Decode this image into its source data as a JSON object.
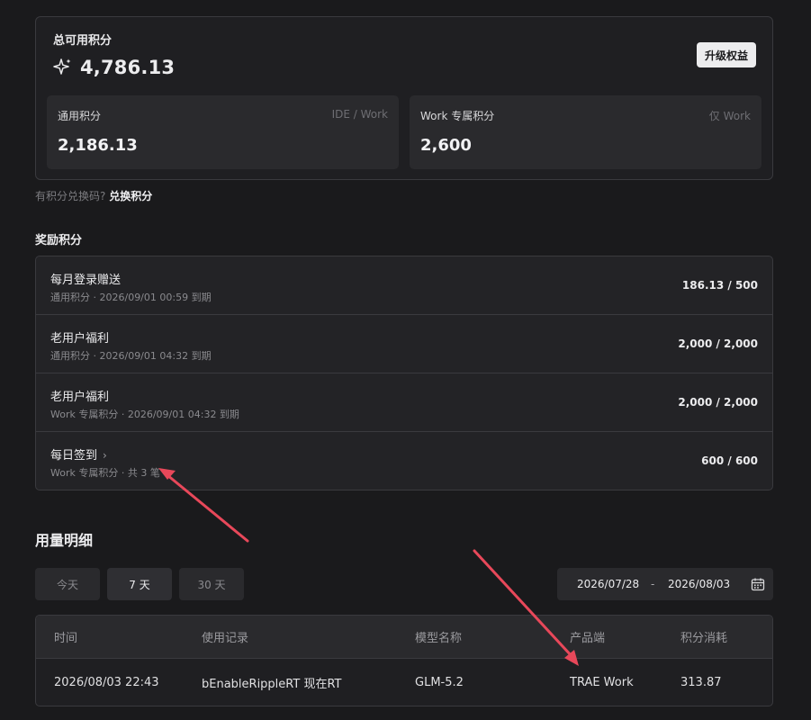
{
  "total": {
    "label": "总可用积分",
    "value": "4,786.13",
    "upgrade_label": "升级权益"
  },
  "general_points": {
    "title": "通用积分",
    "tag": "IDE / Work",
    "value": "2,186.13"
  },
  "work_points": {
    "title": "Work 专属积分",
    "tag": "仅 Work",
    "value": "2,600"
  },
  "redeem": {
    "question": "有积分兑换码?",
    "link": "兑换积分"
  },
  "rewards": {
    "title": "奖励积分",
    "items": [
      {
        "name": "每月登录赠送",
        "meta": "通用积分 · 2026/09/01 00:59 到期",
        "amount": "186.13 / 500",
        "has_chevron": false
      },
      {
        "name": "老用户福利",
        "meta": "通用积分 · 2026/09/01 04:32 到期",
        "amount": "2,000 / 2,000",
        "has_chevron": false
      },
      {
        "name": "老用户福利",
        "meta": "Work 专属积分 · 2026/09/01 04:32 到期",
        "amount": "2,000 / 2,000",
        "has_chevron": false
      },
      {
        "name": "每日签到",
        "meta": "Work 专属积分 · 共 3 笔",
        "amount": "600 / 600",
        "has_chevron": true
      }
    ]
  },
  "usage": {
    "title": "用量明细",
    "range_tabs": [
      {
        "label": "今天",
        "active": false
      },
      {
        "label": "7 天",
        "active": true
      },
      {
        "label": "30 天",
        "active": false
      }
    ],
    "date_start": "2026/07/28",
    "date_separator": "-",
    "date_end": "2026/08/03",
    "table": {
      "headers": [
        "时间",
        "使用记录",
        "模型名称",
        "产品端",
        "积分消耗"
      ],
      "rows": [
        [
          "2026/08/03 22:43",
          "bEnableRippleRT 现在RT",
          "GLM-5.2",
          "TRAE Work",
          "313.87"
        ]
      ]
    }
  },
  "colors": {
    "background": "#1a1a1c",
    "card": "#2a2a2d",
    "border": "#3a3a3e",
    "annotation_arrow": "#e8485a"
  }
}
